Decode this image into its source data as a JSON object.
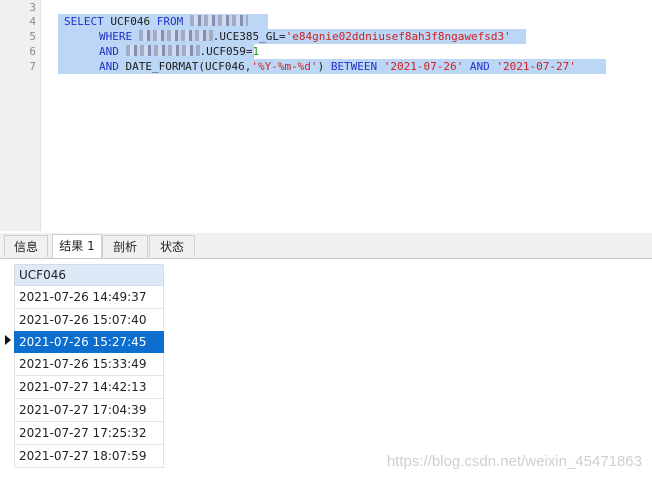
{
  "editor": {
    "line_numbers": [
      "3",
      "4",
      "5",
      "6",
      "7"
    ],
    "line4": {
      "kw1": "SELECT",
      "col": " UCF046 ",
      "kw2": "FROM",
      "gap": " "
    },
    "line5": {
      "kw": "WHERE",
      "mid": ".UCE385_GL=",
      "str": "'e84gnie02ddniusef8ah3f8ngawefsd3'"
    },
    "line6": {
      "kw": "AND",
      "mid": ".UCF059=",
      "num": "1"
    },
    "line7": {
      "kw": "AND",
      "fn": " DATE_FORMAT(UCF046,",
      "fmt": "'%Y-%m-%d'",
      "close": ") ",
      "kw2": "BETWEEN",
      "d1": "'2021-07-26'",
      "kw3": "AND",
      "d2": "'2021-07-27'"
    }
  },
  "tabs": [
    {
      "label": "信息"
    },
    {
      "label": "结果 1"
    },
    {
      "label": "剖析"
    },
    {
      "label": "状态"
    }
  ],
  "results": {
    "column": "UCF046",
    "rows": [
      "2021-07-26 14:49:37",
      "2021-07-26 15:07:40",
      "2021-07-26 15:27:45",
      "2021-07-26 15:33:49",
      "2021-07-27 14:42:13",
      "2021-07-27 17:04:39",
      "2021-07-27 17:25:32",
      "2021-07-27 18:07:59"
    ],
    "selected_row": 3
  },
  "watermark": "https://blog.csdn.net/weixin_45471863",
  "colors": {
    "keyword": "#2530c8",
    "string": "#d01f1f",
    "number": "#1a9a1a",
    "selection": "#bcd7f5",
    "selected_row": "#0c6fd0"
  }
}
